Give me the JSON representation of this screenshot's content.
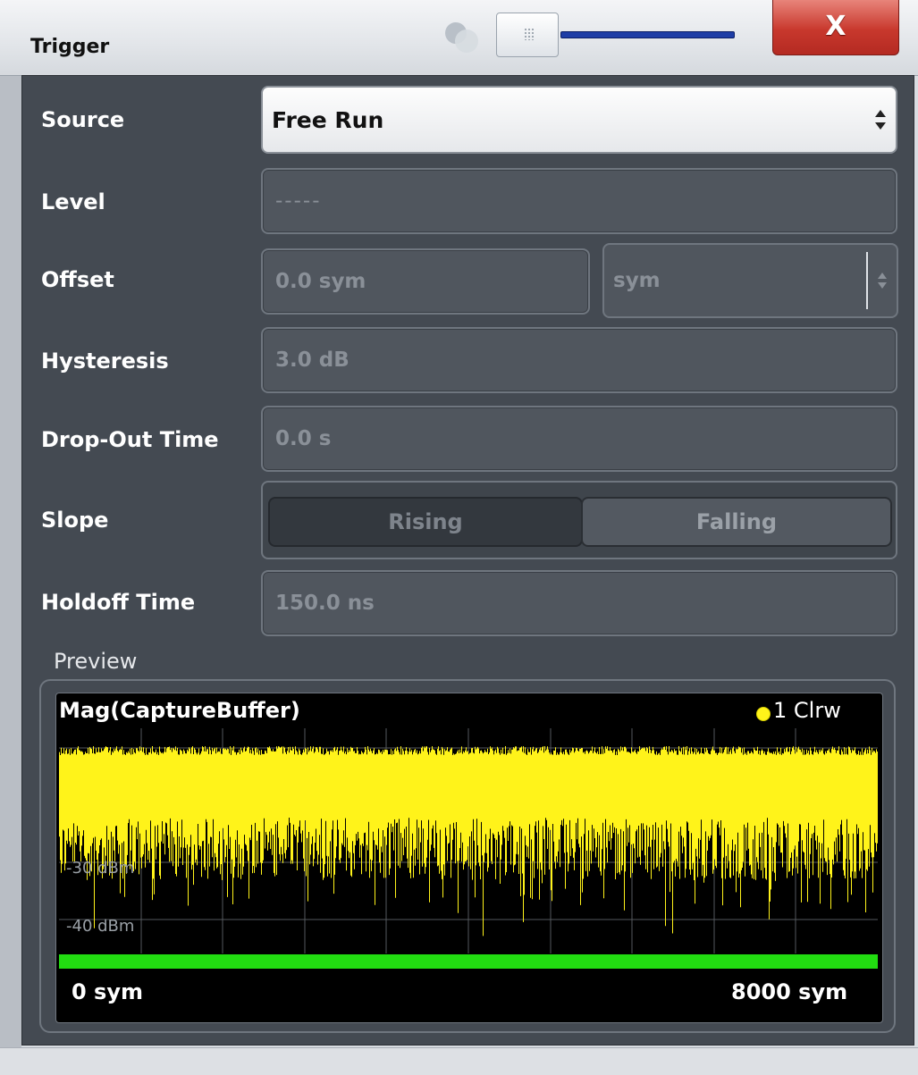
{
  "window": {
    "title": "Trigger",
    "close_label": "X"
  },
  "source": {
    "label": "Source",
    "value": "Free Run"
  },
  "level": {
    "label": "Level",
    "value": "-----"
  },
  "offset": {
    "label": "Offset",
    "value": "0.0 sym",
    "unit": "sym"
  },
  "hysteresis": {
    "label": "Hysteresis",
    "value": "3.0 dB"
  },
  "dropout": {
    "label": "Drop-Out Time",
    "value": "0.0 s"
  },
  "slope": {
    "label": "Slope",
    "options": [
      "Rising",
      "Falling"
    ],
    "selected": "Rising"
  },
  "holdoff": {
    "label": "Holdoff Time",
    "value": "150.0 ns"
  },
  "preview": {
    "label": "Preview",
    "trace_title": "Mag(CaptureBuffer)",
    "trace_indicator": "1 Clrw",
    "y_labels": [
      "-30 dBm",
      "-40 dBm"
    ],
    "x_start": "0 sym",
    "x_end": "8000 sym",
    "colors": {
      "trace": "#fff31a",
      "background": "#000000",
      "grid": "#55595e",
      "capture_bar": "#22dd11"
    }
  }
}
